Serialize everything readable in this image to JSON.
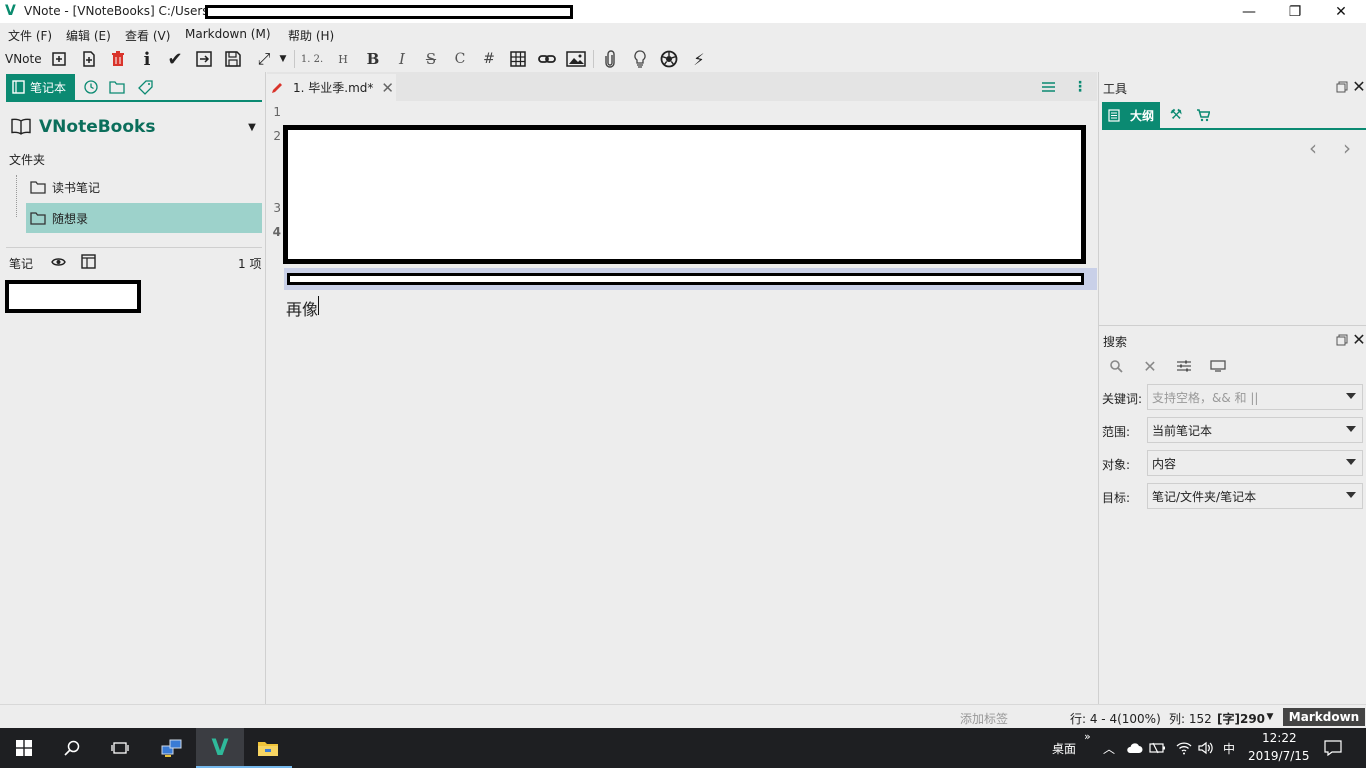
{
  "window": {
    "title": "VNote - [VNoteBooks] C:/Users",
    "logo": "V",
    "controls": {
      "minimize": "—",
      "restore": "❐",
      "close": "✕"
    }
  },
  "menubar": {
    "items": [
      "文件 (F)",
      "编辑 (E)",
      "查看 (V)",
      "Markdown (M)",
      "帮助 (H)"
    ]
  },
  "toolbar": {
    "vnote_label": "VNote",
    "format_numbered": "1. 2.",
    "format_heading": "H",
    "format_bold": "B",
    "format_italic": "I",
    "format_strike": "S",
    "format_code": "C",
    "format_hash": "#"
  },
  "left_panel": {
    "tabs": {
      "notebook_label": "笔记本"
    },
    "notebook_name": "VNoteBooks",
    "folders_label": "文件夹",
    "folders": [
      {
        "name": "读书笔记",
        "selected": false
      },
      {
        "name": "随想录",
        "selected": true
      }
    ],
    "notes_label": "笔记",
    "notes_count": "1 项"
  },
  "editor": {
    "tab_title": "1. 毕业季.md*",
    "line_numbers": [
      "1",
      "2",
      "3",
      "4"
    ],
    "text_last_line": "再像"
  },
  "right_panel": {
    "tools_title": "工具",
    "outline_tab_label": "大纲",
    "search_title": "搜索",
    "search_rows": [
      {
        "label": "关键词:",
        "value": "支持空格，&& 和 ||",
        "placeholder": true
      },
      {
        "label": "范围:",
        "value": "当前笔记本",
        "placeholder": false
      },
      {
        "label": "对象:",
        "value": "内容",
        "placeholder": false
      },
      {
        "label": "目标:",
        "value": "笔记/文件夹/笔记本",
        "placeholder": false
      }
    ]
  },
  "statusbar": {
    "add_tag": "添加标签",
    "position": "行: 4 - 4(100%)",
    "column": "列: 152",
    "word_count": "[字]290",
    "mode": "Markdown"
  },
  "taskbar": {
    "desktop_label": "桌面",
    "ime": "中",
    "time": "12:22",
    "date": "2019/7/15"
  },
  "colors": {
    "accent": "#0b8a72",
    "selection": "#9dd2cb",
    "highlight": "#c9d0e8"
  }
}
